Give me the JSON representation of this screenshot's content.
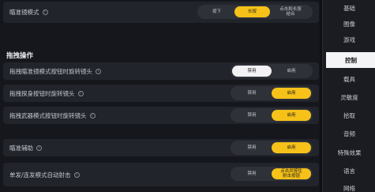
{
  "rows": [
    {
      "label": "瞄准镜模式",
      "options": [
        "按下",
        "长按",
        "点击和长按\n结合"
      ],
      "selected": 1
    },
    {
      "label": "拖拽瞄准镜模式按钮时旋转镜头",
      "options": [
        "禁用",
        "启用"
      ],
      "selected": 0
    },
    {
      "label": "拖拽探身按钮时旋转镜头",
      "options": [
        "禁用",
        "启用"
      ],
      "selected": 1
    },
    {
      "label": "拖拽武器模式按钮时旋转镜头",
      "options": [
        "禁用",
        "启用"
      ],
      "selected": 1
    },
    {
      "label": "瞄准辅助",
      "options": [
        "禁用",
        "启用"
      ],
      "selected": 1
    },
    {
      "label": "单发/连发模式自动射击",
      "options": [
        "禁用",
        "点击并按住\n射击按钮"
      ],
      "selected": 1
    }
  ],
  "section_title": "拖拽操作",
  "info_glyph": "i",
  "sidebar": {
    "items": [
      "基础",
      "图像",
      "游戏",
      "控制",
      "载具",
      "灵敏度",
      "拾取",
      "音频",
      "特殊效果",
      "语言",
      "网络"
    ],
    "active_index": 3
  },
  "colors": {
    "accent": "#f6c219",
    "selected_white": "#f2f2f4"
  }
}
